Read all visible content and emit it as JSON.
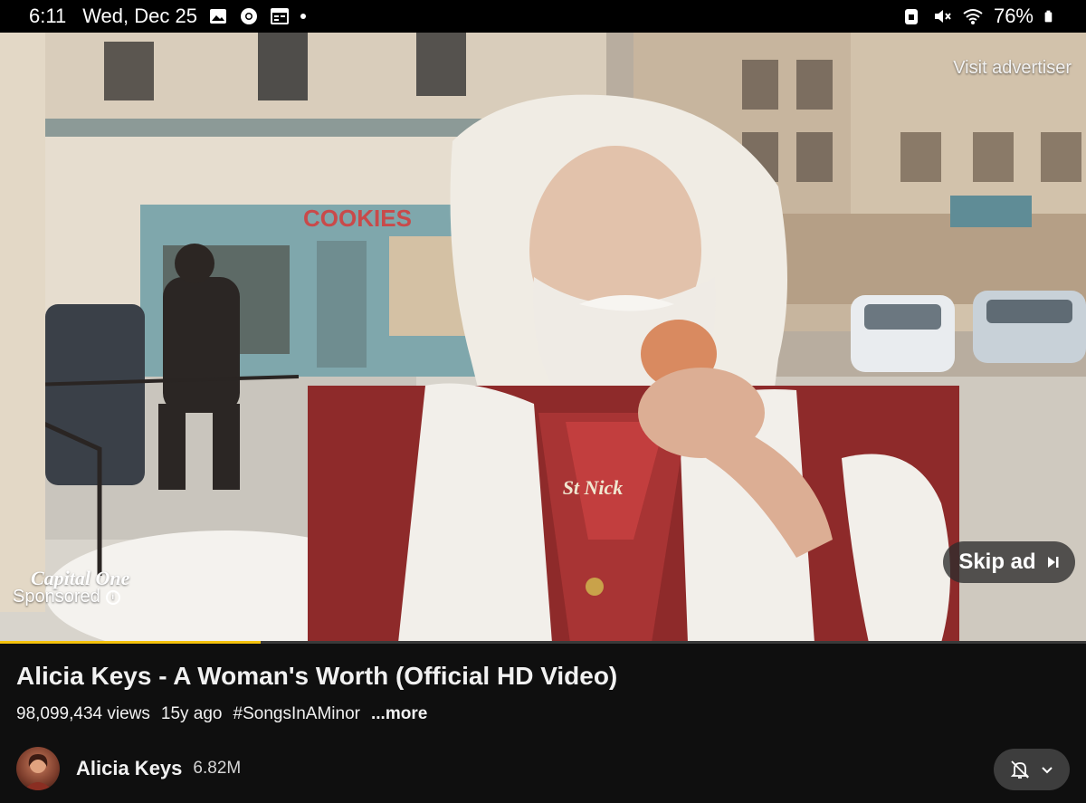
{
  "status_bar": {
    "time": "6:11",
    "date": "Wed, Dec 25",
    "battery": "76%",
    "icons": [
      "gallery-icon",
      "chrome-icon",
      "calendar-icon",
      "more-dot-icon",
      "lock-icon",
      "mute-icon",
      "wifi-icon",
      "battery-icon"
    ]
  },
  "ad": {
    "visit_advertiser": "Visit advertiser",
    "skip_label": "Skip ad",
    "sponsor_logo": "Capital One",
    "sponsored_label": "Sponsored",
    "storefront_sign": "COOKIES",
    "necklace_text": "St Nick",
    "progress": 0.24
  },
  "video": {
    "title": "Alicia Keys - A Woman's Worth (Official HD Video)",
    "views": "98,099,434 views",
    "age": "15y ago",
    "hashtag": "#SongsInAMinor",
    "more": "...more"
  },
  "channel": {
    "name": "Alicia Keys",
    "subscribers": "6.82M"
  },
  "colors": {
    "panel_bg": "#0f0f0f",
    "progress": "#f4c20d",
    "button_bg": "#3d3d3d"
  }
}
